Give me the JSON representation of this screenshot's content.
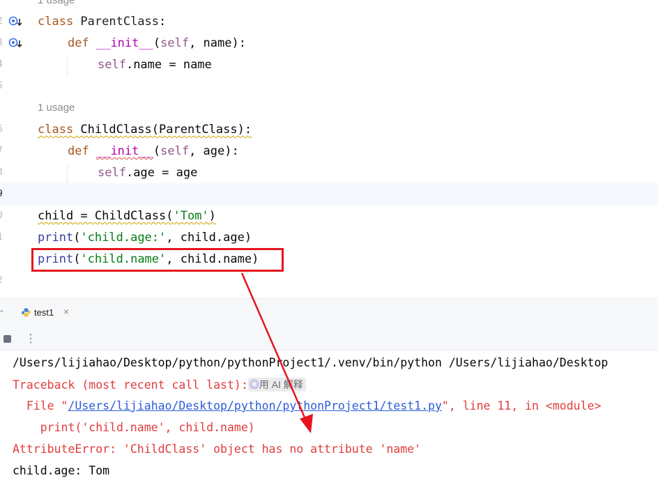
{
  "editor": {
    "usage_hint_top": "1 usage",
    "usage_hint_child": "1 usage",
    "line_numbers": [
      "2",
      "3",
      "4",
      "5",
      "6",
      "7",
      "8",
      "9",
      "0",
      "1",
      "2"
    ],
    "code": {
      "l1_kw": "class",
      "l1_name": " ParentClass",
      "l1_end": ":",
      "l2_kw": "def",
      "l2_fn": "__init__",
      "l2_open": "(",
      "l2_self": "self",
      "l2_rest": ", name):",
      "l3_self": "self",
      "l3_rest": ".name = name",
      "l5_kw": "class",
      "l5_rest": " ChildClass(ParentClass):",
      "l6_kw": "def",
      "l6_fn": "__init__",
      "l6_open": "(",
      "l6_self": "self",
      "l6_rest": ", age):",
      "l7_self": "self",
      "l7_rest": ".age = age",
      "l9_a": "child = ChildClass(",
      "l9_str": "'Tom'",
      "l9_end": ")",
      "l10_fn": "print",
      "l10_open": "(",
      "l10_str": "'child.age:'",
      "l10_rest": ", child.age)",
      "l11_fn": "print",
      "l11_open": "(",
      "l11_str": "'child.name'",
      "l11_rest": ", child.name)"
    }
  },
  "run_panel": {
    "tab_label": "test1",
    "tab_close": "×",
    "more_label": "⋮",
    "pin_label": "-"
  },
  "console": {
    "line1": "/Users/lijiahao/Desktop/python/pythonProject1/.venv/bin/python /Users/lijiahao/Desktop",
    "line2": "Traceback (most recent call last):",
    "ai_chip": "用 AI 解释",
    "line3_pre": "  File \"",
    "line3_link": "/Users/lijiahao/Desktop/python/pythonProject1/test1.py",
    "line3_post": "\", line 11, in <module>",
    "line4": "    print('child.name', child.name)",
    "line5": "AttributeError: 'ChildClass' object has no attribute 'name'",
    "line6": "child.age: Tom"
  },
  "colors": {
    "annotation": "#e6141e",
    "error_text": "#e03c3c",
    "link": "#2a5bd7",
    "tab_underline": "#3574f0"
  }
}
